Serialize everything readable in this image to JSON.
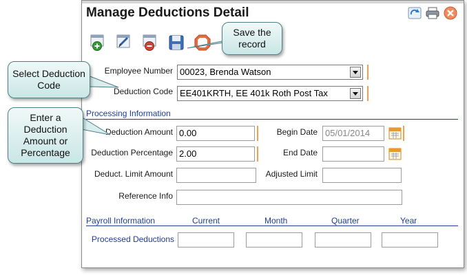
{
  "window": {
    "title": "Manage Deductions Detail"
  },
  "toolbar": {
    "icons": [
      "add-record-icon",
      "edit-record-icon",
      "delete-record-icon",
      "save-icon",
      "cancel-icon"
    ],
    "title_icons": [
      "refresh-icon",
      "print-icon",
      "close-icon"
    ]
  },
  "form": {
    "employee_number": {
      "label": "Employee Number",
      "value": "00023, Brenda Watson"
    },
    "deduction_code": {
      "label": "Deduction Code",
      "value": "EE401KRTH, EE 401k Roth Post Tax"
    },
    "processing_title": "Processing Information",
    "deduction_amount": {
      "label": "Deduction Amount",
      "value": "0.00"
    },
    "deduction_percentage": {
      "label": "Deduction Percentage",
      "value": "2.00"
    },
    "deduct_limit_amount": {
      "label": "Deduct. Limit Amount",
      "value": ""
    },
    "begin_date": {
      "label": "Begin Date",
      "value": "05/01/2014"
    },
    "end_date": {
      "label": "End Date",
      "value": ""
    },
    "adjusted_limit": {
      "label": "Adjusted Limit",
      "value": ""
    },
    "reference_info": {
      "label": "Reference Info",
      "value": ""
    }
  },
  "payroll": {
    "title": "Payroll Information",
    "columns": [
      "Current",
      "Month",
      "Quarter",
      "Year"
    ],
    "row_label": "Processed Deductions"
  },
  "callouts": {
    "save": "Save the record",
    "select_code": "Select Deduction Code",
    "enter_amount": "Enter a Deduction Amount or Percentage"
  },
  "colors": {
    "section_blue": "#1f3d99",
    "required_orange": "#f0a050",
    "callout_border": "#4f7f86"
  }
}
